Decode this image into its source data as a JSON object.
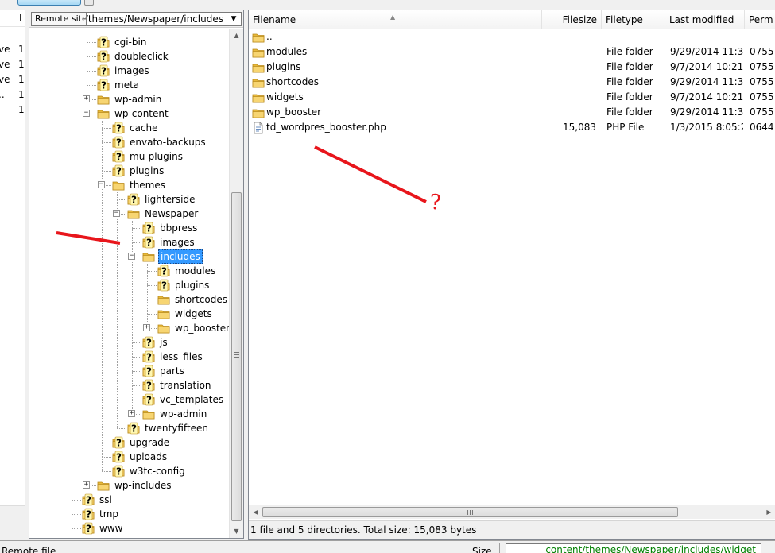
{
  "left_pane": {
    "header_letter": "L",
    "rows": [
      {
        "a": "",
        "b": ""
      },
      {
        "a": "ve",
        "b": "1"
      },
      {
        "a": "ve",
        "b": "1"
      },
      {
        "a": "ve",
        "b": "1"
      },
      {
        "a": "..",
        "b": "1"
      },
      {
        "a": "",
        "b": "1"
      }
    ]
  },
  "remote_site": {
    "label": "Remote site:",
    "path": "ontent/themes/Newspaper/includes",
    "dropdown_glyph": "▼"
  },
  "tree": {
    "nodes": [
      {
        "label": "cgi-bin",
        "icon": "folder-question-icon"
      },
      {
        "label": "doubleclick",
        "icon": "folder-question-icon"
      },
      {
        "label": "images",
        "icon": "folder-question-icon"
      },
      {
        "label": "meta",
        "icon": "folder-question-icon"
      },
      {
        "label": "wp-admin",
        "icon": "folder-icon",
        "expander": "+"
      },
      {
        "label": "wp-content",
        "icon": "folder-icon",
        "expander": "−"
      },
      {
        "label": "cache",
        "icon": "folder-question-icon"
      },
      {
        "label": "envato-backups",
        "icon": "folder-question-icon"
      },
      {
        "label": "mu-plugins",
        "icon": "folder-question-icon"
      },
      {
        "label": "plugins",
        "icon": "folder-question-icon"
      },
      {
        "label": "themes",
        "icon": "folder-icon",
        "expander": "−"
      },
      {
        "label": "lighterside",
        "icon": "folder-question-icon"
      },
      {
        "label": "Newspaper",
        "icon": "folder-icon",
        "expander": "−"
      },
      {
        "label": "bbpress",
        "icon": "folder-question-icon"
      },
      {
        "label": "images",
        "icon": "folder-question-icon"
      },
      {
        "label": "includes",
        "icon": "folder-icon",
        "expander": "−",
        "selected": true
      },
      {
        "label": "modules",
        "icon": "folder-question-icon"
      },
      {
        "label": "plugins",
        "icon": "folder-question-icon"
      },
      {
        "label": "shortcodes",
        "icon": "folder-icon"
      },
      {
        "label": "widgets",
        "icon": "folder-icon"
      },
      {
        "label": "wp_booster",
        "icon": "folder-icon",
        "expander": "+"
      },
      {
        "label": "js",
        "icon": "folder-question-icon"
      },
      {
        "label": "less_files",
        "icon": "folder-question-icon"
      },
      {
        "label": "parts",
        "icon": "folder-question-icon"
      },
      {
        "label": "translation",
        "icon": "folder-question-icon"
      },
      {
        "label": "vc_templates",
        "icon": "folder-question-icon"
      },
      {
        "label": "wp-admin",
        "icon": "folder-icon",
        "expander": "+"
      },
      {
        "label": "twentyfifteen",
        "icon": "folder-question-icon"
      },
      {
        "label": "upgrade",
        "icon": "folder-question-icon"
      },
      {
        "label": "uploads",
        "icon": "folder-question-icon"
      },
      {
        "label": "w3tc-config",
        "icon": "folder-question-icon"
      },
      {
        "label": "wp-includes",
        "icon": "folder-icon",
        "expander": "+"
      },
      {
        "label": "ssl",
        "icon": "folder-question-icon"
      },
      {
        "label": "tmp",
        "icon": "folder-question-icon"
      },
      {
        "label": "www",
        "icon": "folder-question-icon"
      }
    ]
  },
  "file_list": {
    "columns": {
      "filename": "Filename",
      "filesize": "Filesize",
      "filetype": "Filetype",
      "last_modified": "Last modified",
      "perm": "Perm"
    },
    "rows": [
      {
        "name": "..",
        "size": "",
        "type": "",
        "modified": "",
        "perm": "",
        "icon": "folder-icon"
      },
      {
        "name": "modules",
        "size": "",
        "type": "File folder",
        "modified": "9/29/2014 11:3...",
        "perm": "0755",
        "icon": "folder-icon"
      },
      {
        "name": "plugins",
        "size": "",
        "type": "File folder",
        "modified": "9/7/2014 10:21:...",
        "perm": "0755",
        "icon": "folder-icon"
      },
      {
        "name": "shortcodes",
        "size": "",
        "type": "File folder",
        "modified": "9/29/2014 11:3...",
        "perm": "0755",
        "icon": "folder-icon"
      },
      {
        "name": "widgets",
        "size": "",
        "type": "File folder",
        "modified": "9/7/2014 10:21:...",
        "perm": "0755",
        "icon": "folder-icon"
      },
      {
        "name": "wp_booster",
        "size": "",
        "type": "File folder",
        "modified": "9/29/2014 11:3...",
        "perm": "0755",
        "icon": "folder-icon"
      },
      {
        "name": "td_wordpres_booster.php",
        "size": "15,083",
        "type": "PHP File",
        "modified": "1/3/2015 8:05:2...",
        "perm": "0644",
        "icon": "php-file-icon"
      }
    ],
    "status": "1 file and 5 directories. Total size: 15,083 bytes"
  },
  "bottom_strip": {
    "left_label": "Remote file",
    "size_label": "Size",
    "path": "content/themes/Newspaper/includes/widget"
  },
  "annotation": {
    "question_mark": "?",
    "color": "#e8151b"
  },
  "colors": {
    "selection": "#3399ff",
    "folder": "#f5c84c",
    "status_path": "#008000"
  }
}
